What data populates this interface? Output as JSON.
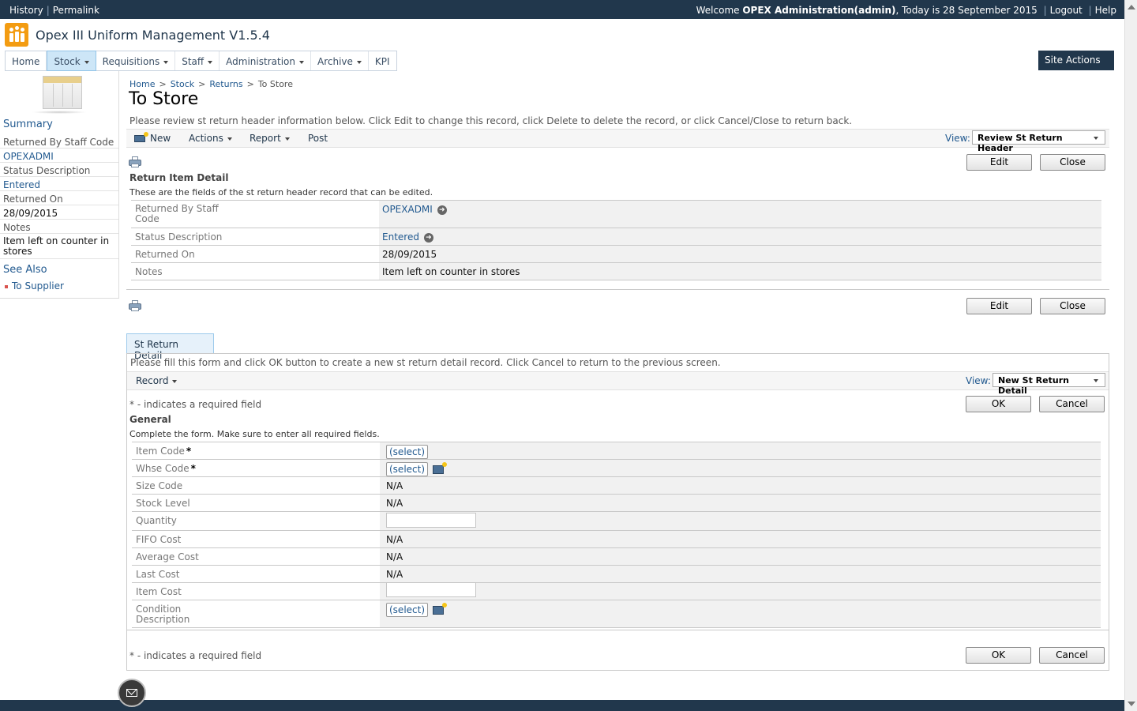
{
  "topbar": {
    "history": "History",
    "permalink": "Permalink",
    "welcome_prefix": "Welcome ",
    "user": "OPEX Administration(admin)",
    "today": ", Today is 28 September 2015",
    "logout": "Logout",
    "help": "Help"
  },
  "site": {
    "title": "Opex III Uniform Management V1.5.4"
  },
  "nav": {
    "home": "Home",
    "stock": "Stock",
    "requisitions": "Requisitions",
    "staff": "Staff",
    "administration": "Administration",
    "archive": "Archive",
    "kpi": "KPI",
    "site_actions": "Site Actions"
  },
  "leftnav": {
    "summary": "Summary",
    "returned_by_label": "Returned By Staff Code",
    "returned_by_value": "OPEXADMI",
    "status_label": "Status Description",
    "status_value": "Entered",
    "returned_on_label": "Returned On",
    "returned_on_value": "28/09/2015",
    "notes_label": "Notes",
    "notes_value": "Item left on counter in stores",
    "see_also": "See Also",
    "to_supplier": "To Supplier"
  },
  "breadcrumb": {
    "home": "Home",
    "stock": "Stock",
    "returns": "Returns",
    "current": "To Store",
    "sep": ">"
  },
  "page": {
    "title": "To Store",
    "description": "Please review st return header information below. Click Edit to change this record, click Delete to delete the record, or click Cancel/Close to return back."
  },
  "toolbar1": {
    "new": "New",
    "actions": "Actions",
    "report": "Report",
    "post": "Post",
    "view_label": "View:",
    "view_value": "Review St Return Header"
  },
  "buttons": {
    "edit": "Edit",
    "close": "Close",
    "ok": "OK",
    "cancel": "Cancel"
  },
  "header_section": {
    "title": "Return Item Detail",
    "desc": "These are the fields of the st return header record that can be edited.",
    "returned_by_label": "Returned By Staff Code",
    "returned_by_value": "OPEXADMI",
    "status_label": "Status Description",
    "status_value": "Entered",
    "returned_on_label": "Returned On",
    "returned_on_value": "28/09/2015",
    "notes_label": "Notes",
    "notes_value": "Item left on counter in stores"
  },
  "detail": {
    "tab": "St Return Detail",
    "description": "Please fill this form and click OK button to create a new st return detail record. Click Cancel to return to the previous screen.",
    "record": "Record",
    "view_label": "View:",
    "view_value": "New St Return Detail",
    "required_note": "* - indicates a required field",
    "section_title": "General",
    "section_desc": "Complete the form. Make sure to enter all required fields.",
    "select": "(select)",
    "req_mark": "*",
    "na": "N/A",
    "fields": {
      "item_code": "Item Code",
      "whse_code": "Whse Code",
      "size_code": "Size Code",
      "stock_level": "Stock Level",
      "quantity": "Quantity",
      "fifo_cost": "FIFO Cost",
      "average_cost": "Average Cost",
      "last_cost": "Last Cost",
      "item_cost": "Item Cost",
      "condition_description": "Condition Description"
    }
  },
  "colors": {
    "brand_dark": "#21374c",
    "link": "#21598f",
    "accent": "#f39c12"
  },
  "icons": [
    "printer-icon",
    "mail-icon",
    "arrow-right-icon",
    "new-item-icon",
    "page-icon",
    "logo-icon"
  ]
}
